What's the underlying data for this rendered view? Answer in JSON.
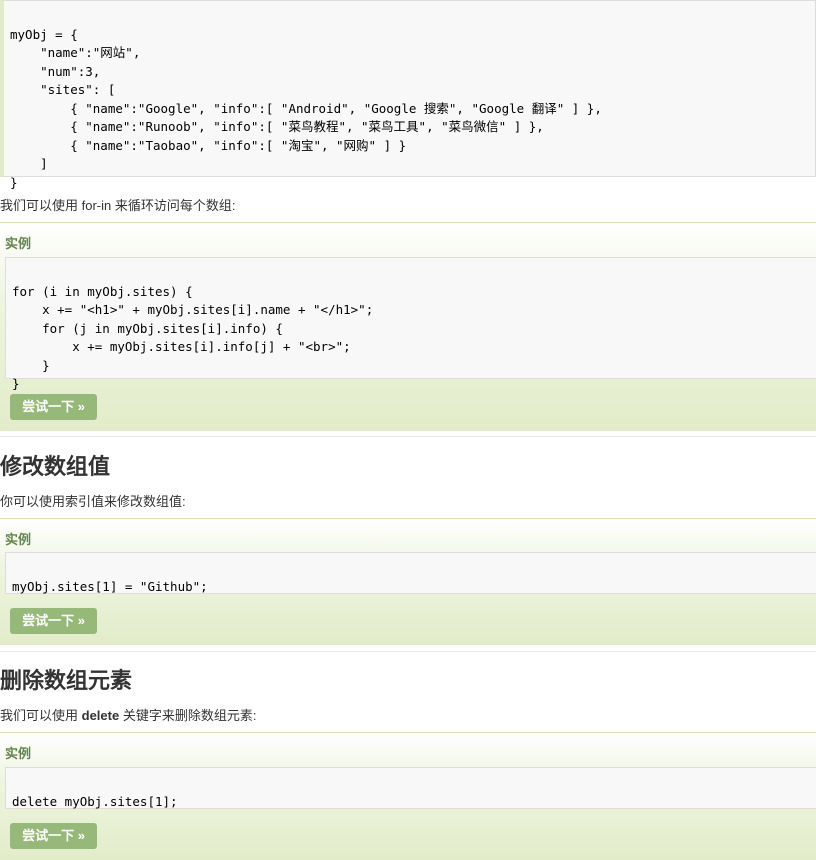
{
  "top_code": {
    "lines": [
      "myObj = {",
      "    \"name\":\"网站\",",
      "    \"num\":3,",
      "    \"sites\": [",
      "        { \"name\":\"Google\", \"info\":[ \"Android\", \"Google 搜索\", \"Google 翻译\" ] },",
      "        { \"name\":\"Runoob\", \"info\":[ \"菜鸟教程\", \"菜鸟工具\", \"菜鸟微信\" ] },",
      "        { \"name\":\"Taobao\", \"info\":[ \"淘宝\", \"网购\" ] }",
      "    ]",
      "}"
    ]
  },
  "section_forin": {
    "intro_prefix": "我们可以使用 for-in 来循环访问每个数组:",
    "example_title": "实例",
    "code_lines": [
      "for (i in myObj.sites) {",
      "    x += \"<h1>\" + myObj.sites[i].name + \"</h1>\";",
      "    for (j in myObj.sites[i].info) {",
      "        x += myObj.sites[i].info[j] + \"<br>\";",
      "    }",
      "}"
    ],
    "try_label": "尝试一下 »"
  },
  "section_modify": {
    "heading": "修改数组值",
    "intro": "你可以使用索引值来修改数组值:",
    "example_title": "实例",
    "code_lines": [
      "myObj.sites[1] = \"Github\";"
    ],
    "try_label": "尝试一下 »"
  },
  "section_delete": {
    "heading": "删除数组元素",
    "intro_prefix": "我们可以使用 ",
    "intro_keyword": "delete",
    "intro_suffix": " 关键字来删除数组元素:",
    "example_title": "实例",
    "code_lines": [
      "delete myObj.sites[1];"
    ],
    "try_label": "尝试一下 »"
  }
}
